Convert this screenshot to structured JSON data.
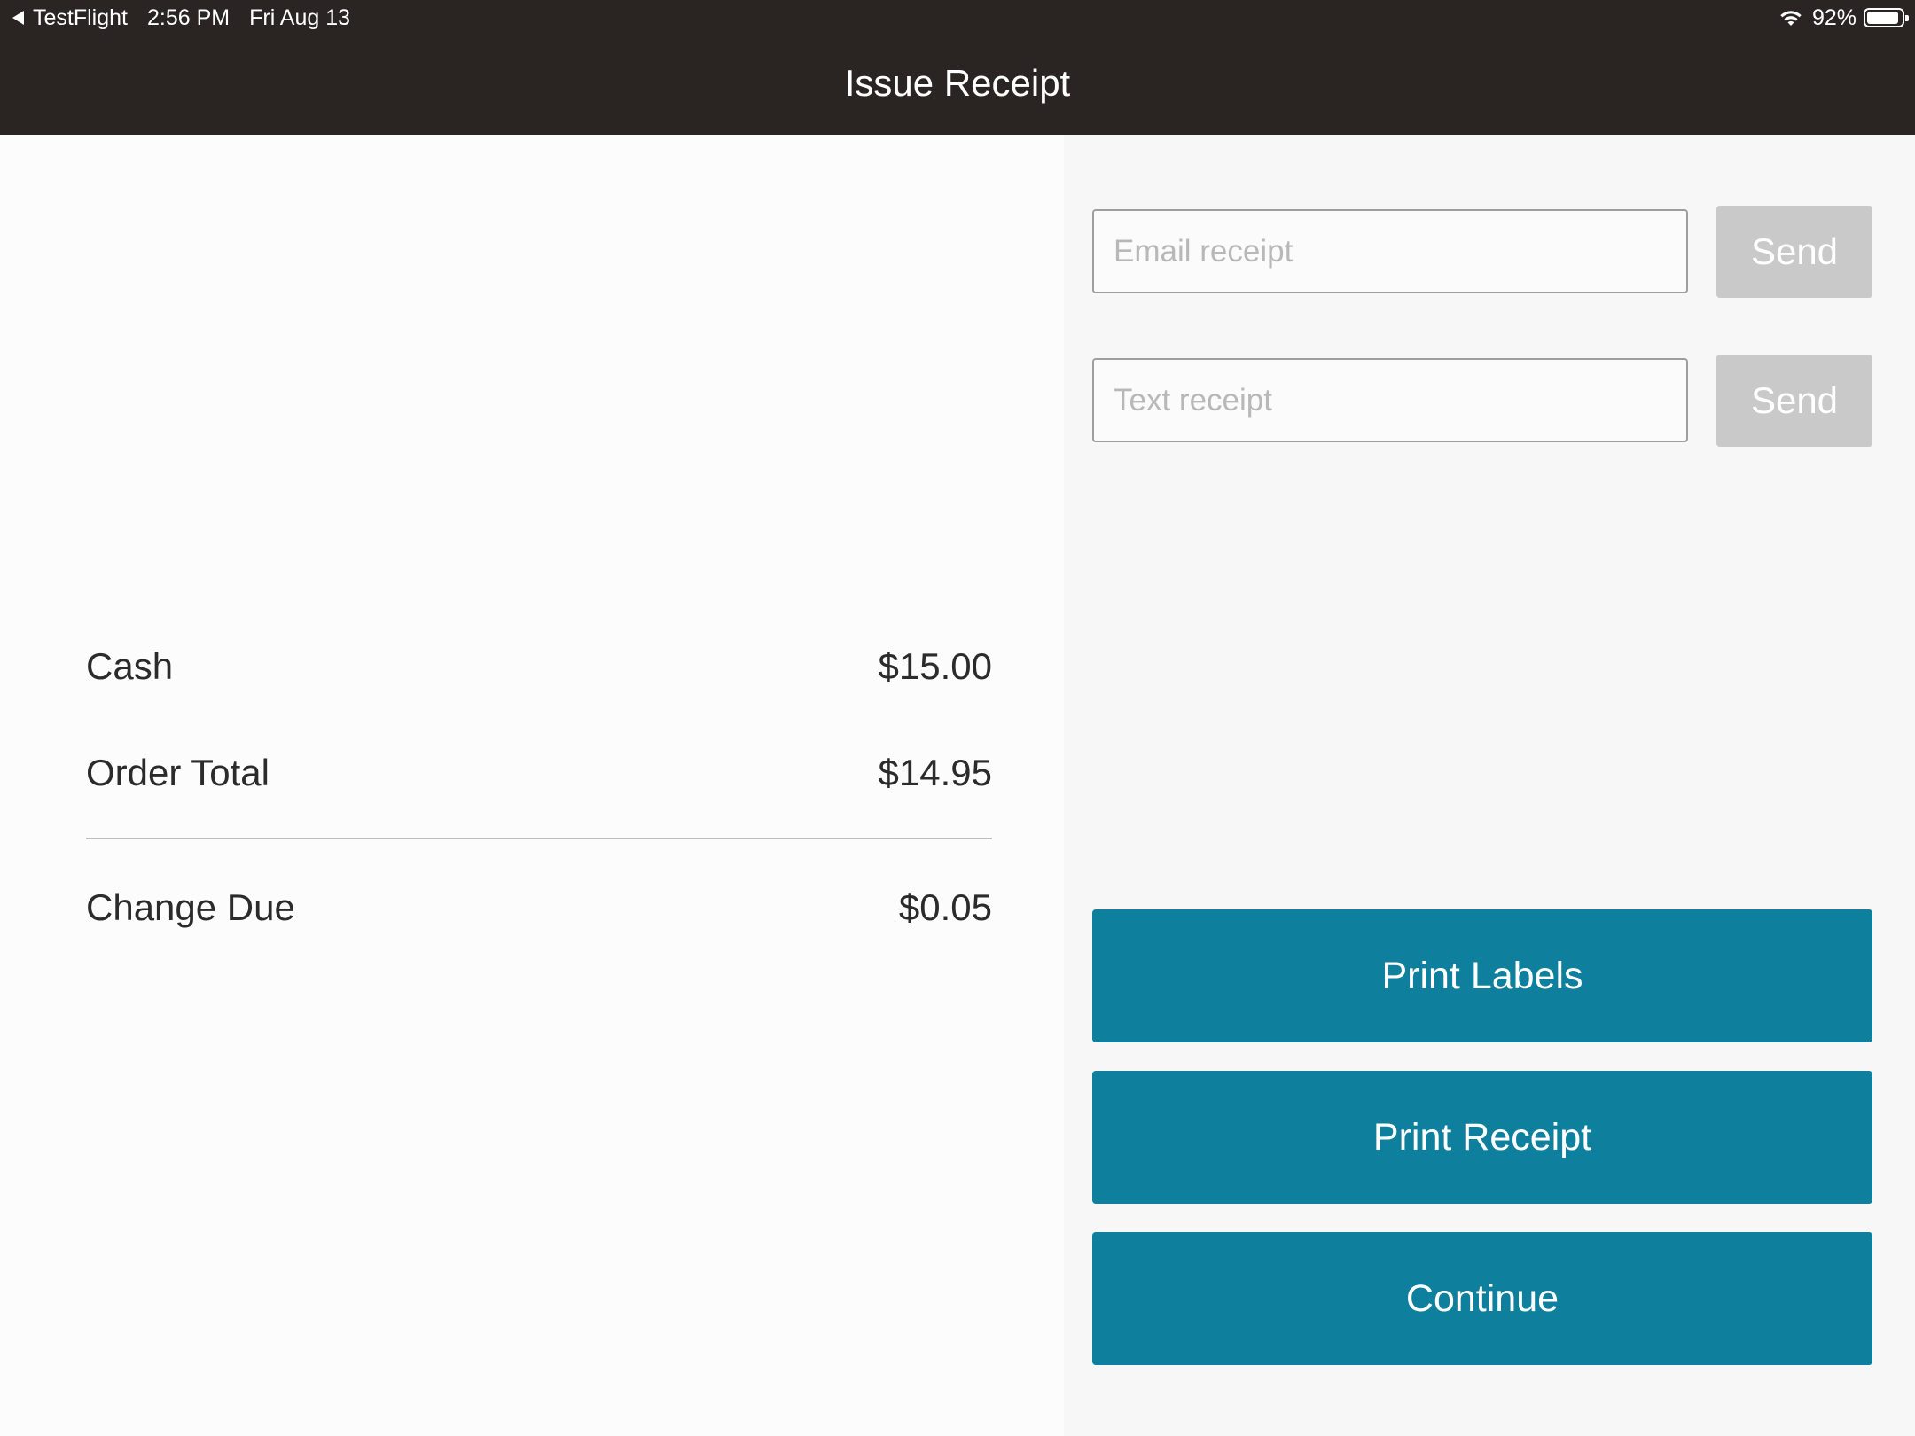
{
  "status_bar": {
    "back_app": "TestFlight",
    "time": "2:56 PM",
    "date": "Fri Aug 13",
    "battery_percent": "92%",
    "battery_level": 0.92
  },
  "header": {
    "title": "Issue Receipt"
  },
  "summary": {
    "cash_label": "Cash",
    "cash_value": "$15.00",
    "order_total_label": "Order Total",
    "order_total_value": "$14.95",
    "change_due_label": "Change Due",
    "change_due_value": "$0.05"
  },
  "receipt_options": {
    "email_placeholder": "Email receipt",
    "email_value": "",
    "text_placeholder": "Text receipt",
    "text_value": "",
    "send_label": "Send"
  },
  "actions": {
    "print_labels": "Print Labels",
    "print_receipt": "Print Receipt",
    "continue": "Continue"
  },
  "colors": {
    "header_bg": "#2a2523",
    "primary_button": "#0e7f9c",
    "disabled_button": "#c9c9c9"
  },
  "icons": {
    "back": "back-caret-icon",
    "wifi": "wifi-icon",
    "battery": "battery-icon"
  }
}
